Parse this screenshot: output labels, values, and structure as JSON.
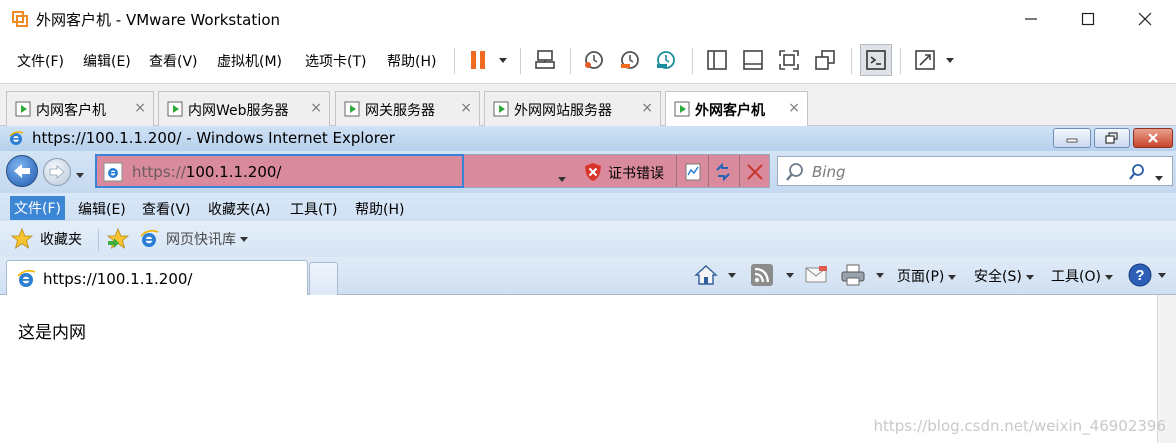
{
  "vmware": {
    "title": "外网客户机 - VMware Workstation",
    "menu": [
      "文件(F)",
      "编辑(E)",
      "查看(V)",
      "虚拟机(M)",
      "选项卡(T)",
      "帮助(H)"
    ],
    "tabs": [
      {
        "label": "内网客户机",
        "active": false
      },
      {
        "label": "内网Web服务器",
        "active": false
      },
      {
        "label": "网关服务器",
        "active": false
      },
      {
        "label": "外网网站服务器",
        "active": false
      },
      {
        "label": "外网客户机",
        "active": true
      }
    ],
    "tab_close": "×",
    "colors": {
      "pause": "#ef6b1f",
      "accent_teal": "#1c8d9d"
    }
  },
  "ie": {
    "title": "https://100.1.1.200/ - Windows Internet Explorer",
    "address": {
      "proto": "https://",
      "host": "100.1.1.200/"
    },
    "cert_error": "证书错误",
    "search_placeholder": "Bing",
    "menu": [
      "文件(F)",
      "编辑(E)",
      "查看(V)",
      "收藏夹(A)",
      "工具(T)",
      "帮助(H)"
    ],
    "favorites_label": "收藏夹",
    "web_slice_label": "网页快讯库",
    "tab_label": "https://100.1.1.200/",
    "commands": {
      "page": "页面(P)",
      "safety": "安全(S)",
      "tools": "工具(O)"
    },
    "colors": {
      "address_bg": "#d98a9c",
      "menu_active": "#3c86d6"
    }
  },
  "page": {
    "body_text": "这是内网"
  },
  "watermark": "https://blog.csdn.net/weixin_46902396"
}
